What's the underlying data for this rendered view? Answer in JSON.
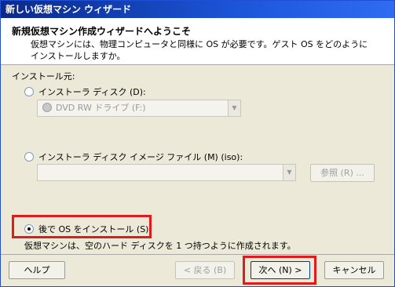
{
  "window": {
    "title": "新しい仮想マシン ウィザード"
  },
  "header": {
    "title": "新規仮想マシン作成ウィザードへようこそ",
    "description": "仮想マシンには、物理コンピュータと同様に OS が必要です。ゲスト OS をどのようにインストールしますか。"
  },
  "install_source": {
    "label": "インストール元:",
    "option_disc": "インストーラ ディスク (D):",
    "disc_select_value": "DVD RW ドライブ (F:)",
    "option_image": "インストーラ ディスク イメージ ファイル (M) (iso):",
    "image_select_value": "",
    "browse_label": "参照 (R) ...",
    "option_later": "後で OS をインストール (S)",
    "selected": "later"
  },
  "note": "仮想マシンは、空のハード ディスクを 1 つ持つように作成されます。",
  "buttons": {
    "help": "ヘルプ",
    "back": "< 戻る (B)",
    "next": "次へ (N) >",
    "cancel": "キャンセル"
  },
  "colors": {
    "highlight": "#e01b1b",
    "titlebar": "#1c55d8"
  }
}
